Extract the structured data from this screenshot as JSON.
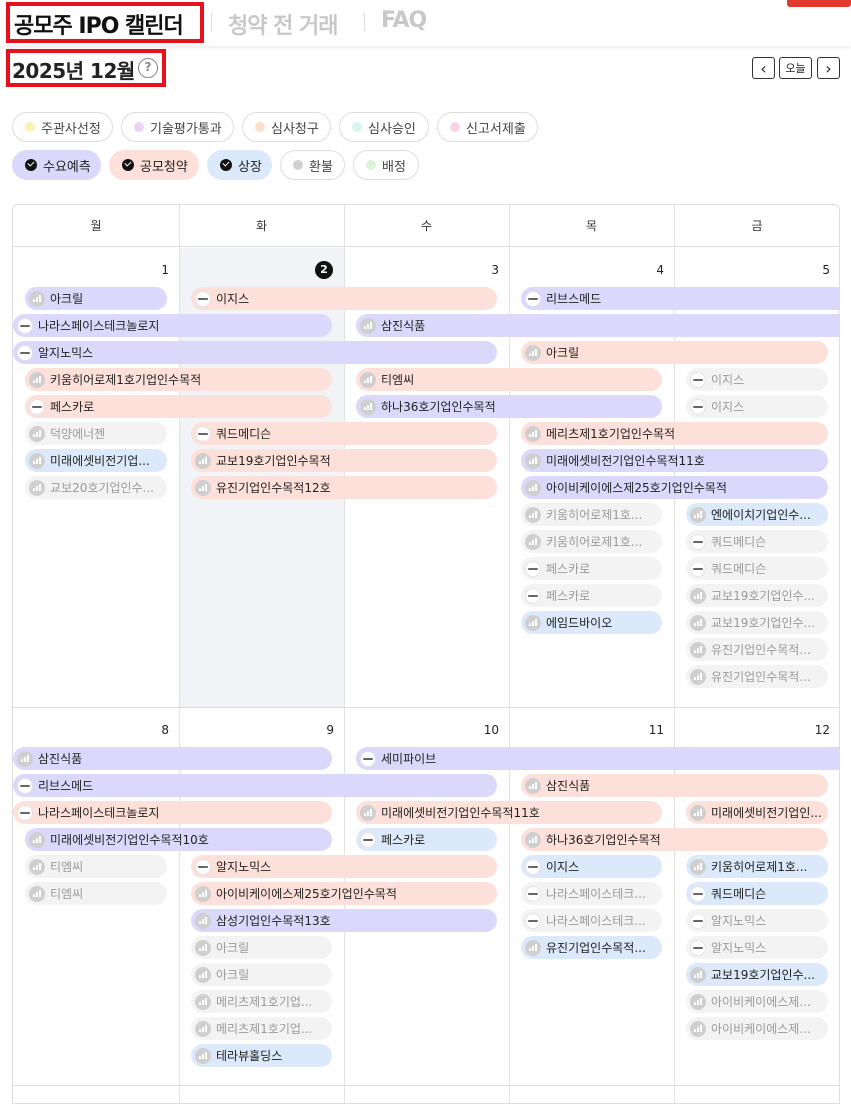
{
  "nav": {
    "tab1": "공모주 IPO 캘린더",
    "tab2": "청약 전 거래",
    "tab3": "FAQ"
  },
  "header": {
    "month": "2025년 12월",
    "help": "?",
    "prev": "‹",
    "today": "오늘",
    "next": "›"
  },
  "colors": {
    "demand": "#dcd8fb",
    "subscription": "#fde0d9",
    "listing": "#dce9fb",
    "faint": "#f3f3f3",
    "selected_box": "#e8101c"
  },
  "filters_row1": [
    {
      "label": "주관사선정",
      "dot": "#fbf2b0"
    },
    {
      "label": "기술평가통과",
      "dot": "#ecd3f6"
    },
    {
      "label": "심사청구",
      "dot": "#fde0cb"
    },
    {
      "label": "심사승인",
      "dot": "#d6f5f0"
    },
    {
      "label": "신고서제출",
      "dot": "#fbd2e5"
    }
  ],
  "filters_row2": [
    {
      "label": "수요예측",
      "checked": true,
      "bg": "#dcd8fb"
    },
    {
      "label": "공모청약",
      "checked": true,
      "bg": "#fde0d9"
    },
    {
      "label": "상장",
      "checked": true,
      "bg": "#dce9fb"
    },
    {
      "label": "환불",
      "checked": false,
      "dot": "#d0d0d0"
    },
    {
      "label": "배정",
      "checked": false,
      "dot": "#d9f3d4"
    }
  ],
  "weekdays": [
    "월",
    "화",
    "수",
    "목",
    "금"
  ],
  "weeks": [
    {
      "days": [
        "1",
        "2",
        "3",
        "4",
        "5"
      ],
      "today_index": 1
    },
    {
      "days": [
        "8",
        "9",
        "10",
        "11",
        "12"
      ],
      "today_index": -1
    }
  ],
  "events": [
    {
      "w": 0,
      "slot": 0,
      "start": 0,
      "end": 0,
      "name": "아크릴",
      "type": "demand",
      "icon": "bars"
    },
    {
      "w": 0,
      "slot": 0,
      "start": 1,
      "end": 2,
      "name": "이지스",
      "type": "subscription",
      "icon": "logo"
    },
    {
      "w": 0,
      "slot": 0,
      "start": 3,
      "end": 5,
      "name": "리브스메드",
      "type": "demand",
      "icon": "logo"
    },
    {
      "w": 0,
      "slot": 1,
      "start": 0,
      "end": 1,
      "name": "나라스페이스테크놀로지",
      "type": "demand",
      "icon": "logo"
    },
    {
      "w": 0,
      "slot": 1,
      "start": 2,
      "end": 5,
      "name": "삼진식품",
      "type": "demand",
      "icon": "bars"
    },
    {
      "w": 0,
      "slot": 2,
      "start": 0,
      "end": 2,
      "name": "알지노믹스",
      "type": "demand",
      "icon": "logo"
    },
    {
      "w": 0,
      "slot": 2,
      "start": 3,
      "end": 4,
      "name": "아크릴",
      "type": "subscription",
      "icon": "bars"
    },
    {
      "w": 0,
      "slot": 3,
      "start": 0,
      "end": 1,
      "name": "키움히어로제1호기업인수목적",
      "type": "subscription",
      "icon": "bars"
    },
    {
      "w": 0,
      "slot": 3,
      "start": 2,
      "end": 3,
      "name": "티엠씨",
      "type": "subscription",
      "icon": "bars"
    },
    {
      "w": 0,
      "slot": 3,
      "start": 4,
      "end": 4,
      "name": "이지스",
      "type": "faint",
      "icon": "logo"
    },
    {
      "w": 0,
      "slot": 4,
      "start": 0,
      "end": 1,
      "name": "페스카로",
      "type": "subscription",
      "icon": "logo"
    },
    {
      "w": 0,
      "slot": 4,
      "start": 2,
      "end": 3,
      "name": "하나36호기업인수목적",
      "type": "demand",
      "icon": "bars"
    },
    {
      "w": 0,
      "slot": 4,
      "start": 4,
      "end": 4,
      "name": "이지스",
      "type": "faint",
      "icon": "logo"
    },
    {
      "w": 0,
      "slot": 5,
      "start": 0,
      "end": 0,
      "name": "덕양에너젠",
      "type": "faint",
      "icon": "bars"
    },
    {
      "w": 0,
      "slot": 5,
      "start": 1,
      "end": 2,
      "name": "쿼드메디슨",
      "type": "subscription",
      "icon": "logo"
    },
    {
      "w": 0,
      "slot": 5,
      "start": 3,
      "end": 4,
      "name": "메리츠제1호기업인수목적",
      "type": "subscription",
      "icon": "bars"
    },
    {
      "w": 0,
      "slot": 6,
      "start": 0,
      "end": 0,
      "name": "미래에셋비전기업...",
      "type": "listing",
      "icon": "bars"
    },
    {
      "w": 0,
      "slot": 6,
      "start": 1,
      "end": 2,
      "name": "교보19호기업인수목적",
      "type": "subscription",
      "icon": "bars"
    },
    {
      "w": 0,
      "slot": 6,
      "start": 3,
      "end": 4,
      "name": "미래에셋비전기업인수목적11호",
      "type": "demand",
      "icon": "bars"
    },
    {
      "w": 0,
      "slot": 7,
      "start": 0,
      "end": 0,
      "name": "교보20호기업인수...",
      "type": "faint",
      "icon": "bars"
    },
    {
      "w": 0,
      "slot": 7,
      "start": 1,
      "end": 2,
      "name": "유진기업인수목적12호",
      "type": "subscription",
      "icon": "bars"
    },
    {
      "w": 0,
      "slot": 7,
      "start": 3,
      "end": 4,
      "name": "아이비케이에스제25호기업인수목적",
      "type": "demand",
      "icon": "bars"
    },
    {
      "w": 0,
      "slot": 8,
      "start": 3,
      "end": 3,
      "name": "키움히어로제1호...",
      "type": "faint",
      "icon": "bars"
    },
    {
      "w": 0,
      "slot": 8,
      "start": 4,
      "end": 4,
      "name": "엔에이치기업인수...",
      "type": "listing",
      "icon": "bars"
    },
    {
      "w": 0,
      "slot": 9,
      "start": 3,
      "end": 3,
      "name": "키움히어로제1호...",
      "type": "faint",
      "icon": "bars"
    },
    {
      "w": 0,
      "slot": 9,
      "start": 4,
      "end": 4,
      "name": "쿼드메디슨",
      "type": "faint",
      "icon": "logo"
    },
    {
      "w": 0,
      "slot": 10,
      "start": 3,
      "end": 3,
      "name": "페스카로",
      "type": "faint",
      "icon": "logo"
    },
    {
      "w": 0,
      "slot": 10,
      "start": 4,
      "end": 4,
      "name": "쿼드메디슨",
      "type": "faint",
      "icon": "logo"
    },
    {
      "w": 0,
      "slot": 11,
      "start": 3,
      "end": 3,
      "name": "페스카로",
      "type": "faint",
      "icon": "logo"
    },
    {
      "w": 0,
      "slot": 11,
      "start": 4,
      "end": 4,
      "name": "교보19호기업인수...",
      "type": "faint",
      "icon": "bars"
    },
    {
      "w": 0,
      "slot": 12,
      "start": 3,
      "end": 3,
      "name": "에임드바이오",
      "type": "listing",
      "icon": "bars"
    },
    {
      "w": 0,
      "slot": 12,
      "start": 4,
      "end": 4,
      "name": "교보19호기업인수...",
      "type": "faint",
      "icon": "bars"
    },
    {
      "w": 0,
      "slot": 13,
      "start": 4,
      "end": 4,
      "name": "유진기업인수목적...",
      "type": "faint",
      "icon": "bars"
    },
    {
      "w": 0,
      "slot": 14,
      "start": 4,
      "end": 4,
      "name": "유진기업인수목적...",
      "type": "faint",
      "icon": "bars"
    },
    {
      "w": 1,
      "slot": 0,
      "start": 0,
      "end": 1,
      "name": "삼진식품",
      "type": "demand",
      "icon": "bars"
    },
    {
      "w": 1,
      "slot": 0,
      "start": 2,
      "end": 5,
      "name": "세미파이브",
      "type": "demand",
      "icon": "logo"
    },
    {
      "w": 1,
      "slot": 1,
      "start": 0,
      "end": 2,
      "name": "리브스메드",
      "type": "demand",
      "icon": "logo"
    },
    {
      "w": 1,
      "slot": 1,
      "start": 3,
      "end": 4,
      "name": "삼진식품",
      "type": "subscription",
      "icon": "bars"
    },
    {
      "w": 1,
      "slot": 2,
      "start": 0,
      "end": 1,
      "name": "나라스페이스테크놀로지",
      "type": "subscription",
      "icon": "logo"
    },
    {
      "w": 1,
      "slot": 2,
      "start": 2,
      "end": 3,
      "name": "미래에셋비전기업인수목적11호",
      "type": "subscription",
      "icon": "bars"
    },
    {
      "w": 1,
      "slot": 2,
      "start": 4,
      "end": 4,
      "name": "미래에셋비전기업인...",
      "type": "subscription",
      "icon": "bars"
    },
    {
      "w": 1,
      "slot": 3,
      "start": 0,
      "end": 1,
      "name": "미래에셋비전기업인수목적10호",
      "type": "demand",
      "icon": "bars"
    },
    {
      "w": 1,
      "slot": 3,
      "start": 2,
      "end": 2,
      "name": "페스카로",
      "type": "listing",
      "icon": "logo"
    },
    {
      "w": 1,
      "slot": 3,
      "start": 3,
      "end": 4,
      "name": "하나36호기업인수목적",
      "type": "subscription",
      "icon": "bars"
    },
    {
      "w": 1,
      "slot": 4,
      "start": 0,
      "end": 0,
      "name": "티엠씨",
      "type": "faint",
      "icon": "bars"
    },
    {
      "w": 1,
      "slot": 4,
      "start": 1,
      "end": 2,
      "name": "알지노믹스",
      "type": "subscription",
      "icon": "logo"
    },
    {
      "w": 1,
      "slot": 4,
      "start": 3,
      "end": 3,
      "name": "이지스",
      "type": "listing",
      "icon": "logo"
    },
    {
      "w": 1,
      "slot": 4,
      "start": 4,
      "end": 4,
      "name": "키움히어로제1호...",
      "type": "listing",
      "icon": "bars"
    },
    {
      "w": 1,
      "slot": 5,
      "start": 0,
      "end": 0,
      "name": "티엠씨",
      "type": "faint",
      "icon": "bars"
    },
    {
      "w": 1,
      "slot": 5,
      "start": 1,
      "end": 2,
      "name": "아이비케이에스제25호기업인수목적",
      "type": "subscription",
      "icon": "bars"
    },
    {
      "w": 1,
      "slot": 5,
      "start": 3,
      "end": 3,
      "name": "나라스페이스테크...",
      "type": "faint",
      "icon": "logo"
    },
    {
      "w": 1,
      "slot": 5,
      "start": 4,
      "end": 4,
      "name": "쿼드메디슨",
      "type": "listing",
      "icon": "logo"
    },
    {
      "w": 1,
      "slot": 6,
      "start": 1,
      "end": 2,
      "name": "삼성기업인수목적13호",
      "type": "demand",
      "icon": "bars"
    },
    {
      "w": 1,
      "slot": 6,
      "start": 3,
      "end": 3,
      "name": "나라스페이스테크...",
      "type": "faint",
      "icon": "logo"
    },
    {
      "w": 1,
      "slot": 6,
      "start": 4,
      "end": 4,
      "name": "알지노믹스",
      "type": "faint",
      "icon": "logo"
    },
    {
      "w": 1,
      "slot": 7,
      "start": 1,
      "end": 1,
      "name": "아크릴",
      "type": "faint",
      "icon": "bars"
    },
    {
      "w": 1,
      "slot": 7,
      "start": 3,
      "end": 3,
      "name": "유진기업인수목적...",
      "type": "listing",
      "icon": "bars"
    },
    {
      "w": 1,
      "slot": 7,
      "start": 4,
      "end": 4,
      "name": "알지노믹스",
      "type": "faint",
      "icon": "logo"
    },
    {
      "w": 1,
      "slot": 8,
      "start": 1,
      "end": 1,
      "name": "아크릴",
      "type": "faint",
      "icon": "bars"
    },
    {
      "w": 1,
      "slot": 8,
      "start": 4,
      "end": 4,
      "name": "교보19호기업인수...",
      "type": "listing",
      "icon": "bars"
    },
    {
      "w": 1,
      "slot": 9,
      "start": 1,
      "end": 1,
      "name": "메리츠제1호기업...",
      "type": "faint",
      "icon": "bars"
    },
    {
      "w": 1,
      "slot": 9,
      "start": 4,
      "end": 4,
      "name": "아이비케이에스제...",
      "type": "faint",
      "icon": "bars"
    },
    {
      "w": 1,
      "slot": 10,
      "start": 1,
      "end": 1,
      "name": "메리츠제1호기업...",
      "type": "faint",
      "icon": "bars"
    },
    {
      "w": 1,
      "slot": 10,
      "start": 4,
      "end": 4,
      "name": "아이비케이에스제...",
      "type": "faint",
      "icon": "bars"
    },
    {
      "w": 1,
      "slot": 11,
      "start": 1,
      "end": 1,
      "name": "테라뷰홀딩스",
      "type": "listing",
      "icon": "bars"
    }
  ]
}
